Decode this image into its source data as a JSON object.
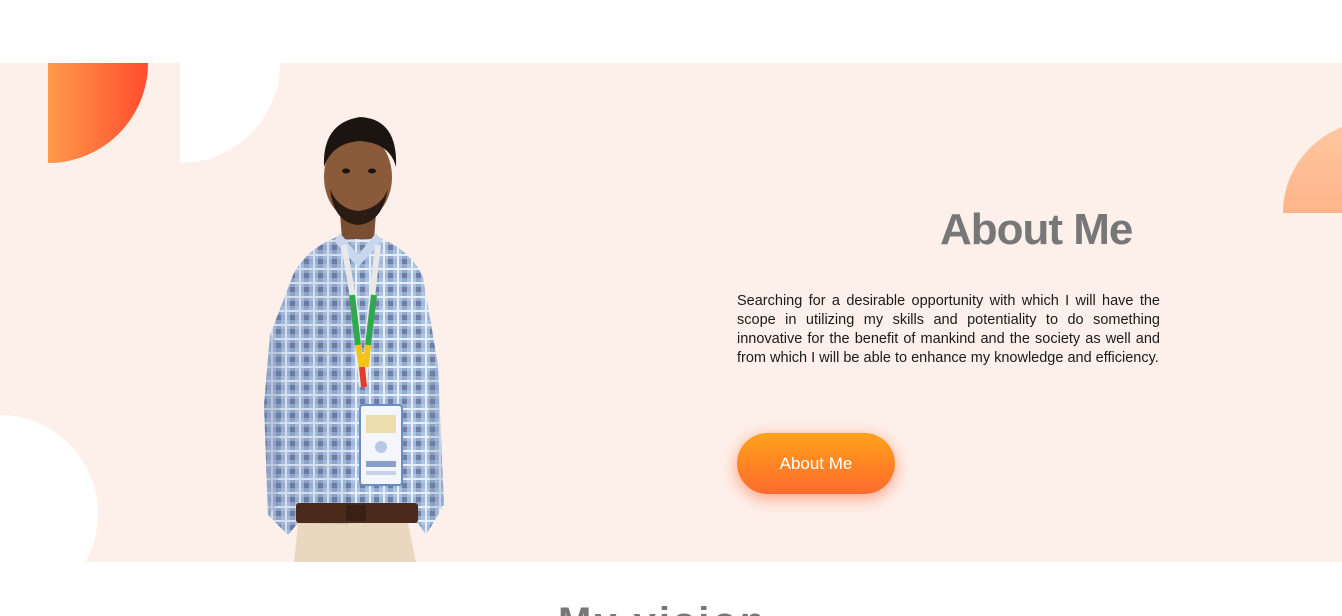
{
  "about": {
    "title": "About Me",
    "description": "Searching for a desirable opportunity with which I will have the scope in utilizing my skills and potentiality to do something innovative for the benefit of mankind and the society as well and from which I will be able to enhance my knowledge and efficiency.",
    "button_label": "About Me",
    "portrait_alt": "Portrait of a man in a checked shirt wearing a lanyard and ID badge"
  },
  "next_section": {
    "heading_peek": "My vision"
  },
  "colors": {
    "section_background": "#fdf0ea",
    "accent_orange": "#ff6a2e",
    "accent_yellow": "#ffa21a",
    "title_gray": "#777777"
  }
}
